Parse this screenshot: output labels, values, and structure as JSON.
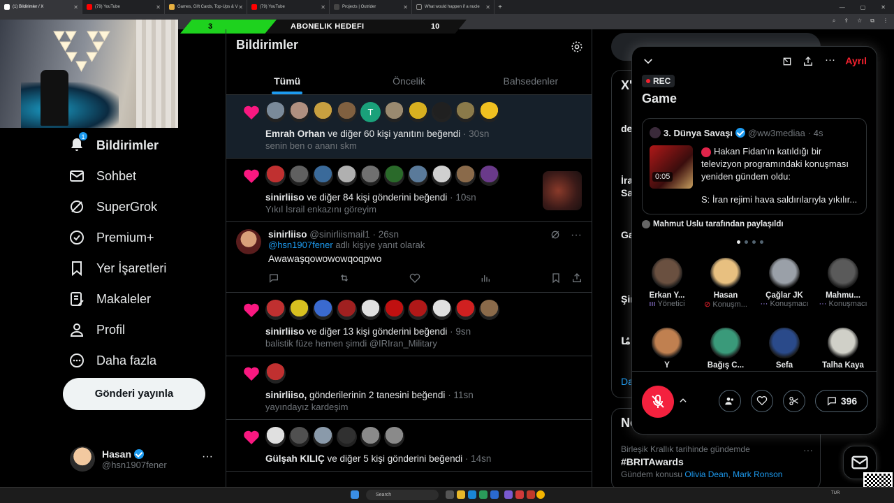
{
  "browser": {
    "tabs": [
      {
        "label": "(1) Bildirimler / X",
        "active": true
      },
      {
        "label": "(79) YouTube"
      },
      {
        "label": "Games, Gift Cards, Top-Ups & V"
      },
      {
        "label": "(79) YouTube"
      },
      {
        "label": "Projects | Outrider"
      },
      {
        "label": "What would happen if a nucle"
      }
    ],
    "new_tab": "+"
  },
  "overlay": {
    "current": "3",
    "title": "ABONELIK HEDEFI",
    "target": "10"
  },
  "nav": {
    "badge": "1",
    "items": [
      {
        "label": "Bildirimler",
        "icon": "bell-icon"
      },
      {
        "label": "Sohbet",
        "icon": "mail-icon"
      },
      {
        "label": "SuperGrok",
        "icon": "grok-icon"
      },
      {
        "label": "Premium+",
        "icon": "premium-icon"
      },
      {
        "label": "Yer İşaretleri",
        "icon": "bookmark-icon"
      },
      {
        "label": "Makaleler",
        "icon": "article-icon"
      },
      {
        "label": "Profil",
        "icon": "profile-icon"
      },
      {
        "label": "Daha fazla",
        "icon": "more-icon"
      }
    ],
    "post_button": "Gönderi yayınla"
  },
  "account": {
    "name": "Hasan",
    "handle": "@hsn1907fener",
    "more": "···"
  },
  "main": {
    "title": "Bildirimler",
    "tabs": [
      "Tümü",
      "Öncelik",
      "Bahsedenler"
    ],
    "notifications": [
      {
        "actor": "Emrah Orhan",
        "rest": " ve diğer 60 kişi yanıtını beğendi",
        "time": " · 30sn",
        "sub": "senin ben o ananı skm",
        "avatar_colors": [
          "#7a8a9a",
          "#b09080",
          "#c8a040",
          "#806040",
          "#1aa17a",
          "#9a8a70",
          "#d8b020",
          "#202020",
          "#8a7a4a",
          "#f0c020"
        ],
        "letter": "T"
      },
      {
        "actor": "sinirliiso",
        "rest": " ve diğer 84 kişi gönderini beğendi",
        "time": " · 10sn",
        "sub": "Yıkıl İsrail enkazını göreyim",
        "avatar_colors": [
          "#c03030",
          "#606060",
          "#3a6a9a",
          "#b0b0b0",
          "#707070",
          "#2a6a2a",
          "#5a7a9a",
          "#d0d0d0",
          "#8a6a4a",
          "#6a3a8a"
        ]
      },
      {
        "actor": "sinirliiso",
        "rest": " ve diğer 13 kişi gönderini beğendi",
        "time": " · 9sn",
        "sub": "balistik füze hemen şimdi @IRIran_Military",
        "avatar_colors": [
          "#c03030",
          "#d8c020",
          "#3a6ad0",
          "#a02020",
          "#e0e0e0",
          "#c01010",
          "#b01818",
          "#e0e0e0",
          "#d02020",
          "#8a6a4a"
        ]
      },
      {
        "actor": "sinirliiso,",
        "rest": " gönderilerinin 2 tanesini beğendi",
        "time": " · 11sn",
        "sub": "yayındayız kardeşim",
        "avatar_colors": [
          "#c03030"
        ]
      },
      {
        "actor": "Gülşah KILIÇ",
        "rest": " ve diğer 5 kişi gönderini beğendi",
        "time": " · 14sn",
        "sub": "",
        "avatar_colors": [
          "#e0e0e0",
          "#505050",
          "#8a9aaa",
          "#303030",
          "#8a8a8a",
          "#8a8a8a"
        ]
      }
    ],
    "reply": {
      "name": "sinirliiso",
      "handle": "@sinirliismail1",
      "time": " · 26sn",
      "context_handle": "@hsn1907fener",
      "context_rest": " adlı kişiye yanıt olarak",
      "body": "Awawaşqowowowqoqpwo"
    }
  },
  "space": {
    "leave": "Ayrıl",
    "rec": "REC",
    "title": "Game",
    "tweet": {
      "author": "3. Dünya Savaşı",
      "handle": "@ww3mediaa",
      "time": "· 4s",
      "duration": "0:05",
      "text": "Hakan Fidan'ın katıldığı bir televizyon programındaki konuşması yeniden gündem oldu:",
      "question": "S: İran rejimi hava saldırılarıyla yıkılır..."
    },
    "shared_by": "Mahmut Uslu tarafından paylaşıldı",
    "speakers": [
      {
        "name": "Erkan Y...",
        "role": "Yönetici",
        "color": "#6a5040"
      },
      {
        "name": "Hasan",
        "role": "Konuşm...",
        "color": "#e8c080"
      },
      {
        "name": "Çağlar JK",
        "role": "Konuşmacı",
        "color": "#9aa0a8"
      },
      {
        "name": "Mahmu...",
        "role": "Konuşmacı",
        "color": "#5a5a5a"
      },
      {
        "name": "Y",
        "role": "",
        "color": "#c08050"
      },
      {
        "name": "Bağış C...",
        "role": "",
        "color": "#3a9a7a"
      },
      {
        "name": "Sefa",
        "role": "",
        "color": "#2a4a8a"
      },
      {
        "name": "Talha Kaya",
        "role": "",
        "color": "#d0d0c8"
      }
    ],
    "comment_count": "396"
  },
  "trends": {
    "side_labels": [
      "X'",
      "de",
      "İra",
      "Sa",
      "Ga",
      "Şir",
      "مٌا",
      "Da",
      "No"
    ],
    "context": "Birleşik Krallık tarihinde gündemde",
    "tag": "#BRITAwards",
    "sub_prefix": "Gündem konusu",
    "sub_links": [
      "Olivia Dean",
      "Mark Ronson"
    ],
    "more": "···"
  },
  "taskbar": {
    "search_placeholder": "Search",
    "lang": "TUR"
  },
  "colors": {
    "accent": "#1d9bf0",
    "like": "#f91880",
    "leave": "#f4212e",
    "goal": "#1ed21e"
  }
}
